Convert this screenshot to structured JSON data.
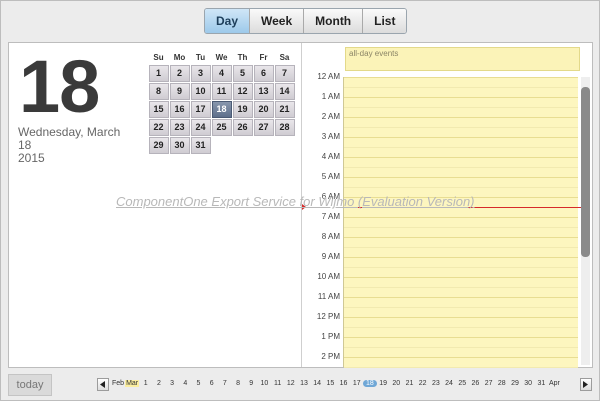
{
  "views": [
    "Day",
    "Week",
    "Month",
    "List"
  ],
  "active_view": "Day",
  "selected": {
    "day": "18",
    "weekday_month": "Wednesday, March",
    "day_line": "18",
    "year": "2015"
  },
  "mini_calendar": {
    "dow": [
      "Su",
      "Mo",
      "Tu",
      "We",
      "Th",
      "Fr",
      "Sa"
    ],
    "days": [
      "1",
      "2",
      "3",
      "4",
      "5",
      "6",
      "7",
      "8",
      "9",
      "10",
      "11",
      "12",
      "13",
      "14",
      "15",
      "16",
      "17",
      "18",
      "19",
      "20",
      "21",
      "22",
      "23",
      "24",
      "25",
      "26",
      "27",
      "28",
      "29",
      "30",
      "31"
    ],
    "today_index": 17
  },
  "schedule": {
    "all_day_label": "all-day events",
    "times": [
      "12 AM",
      "1 AM",
      "2 AM",
      "3 AM",
      "4 AM",
      "5 AM",
      "6 AM",
      "7 AM",
      "8 AM",
      "9 AM",
      "10 AM",
      "11 AM",
      "12 PM",
      "1 PM",
      "2 PM"
    ]
  },
  "watermark": "ComponentOne Export Service for Wijmo (Evaluation Version)",
  "footer": {
    "today_label": "today",
    "prev_month": "Feb",
    "current_month": "Mar",
    "next_month": "Apr",
    "days": [
      "1",
      "2",
      "3",
      "4",
      "5",
      "6",
      "7",
      "8",
      "9",
      "10",
      "11",
      "12",
      "13",
      "14",
      "15",
      "16",
      "17",
      "18",
      "19",
      "20",
      "21",
      "22",
      "23",
      "24",
      "25",
      "26",
      "27",
      "28",
      "29",
      "30",
      "31"
    ],
    "current_index": 17
  }
}
